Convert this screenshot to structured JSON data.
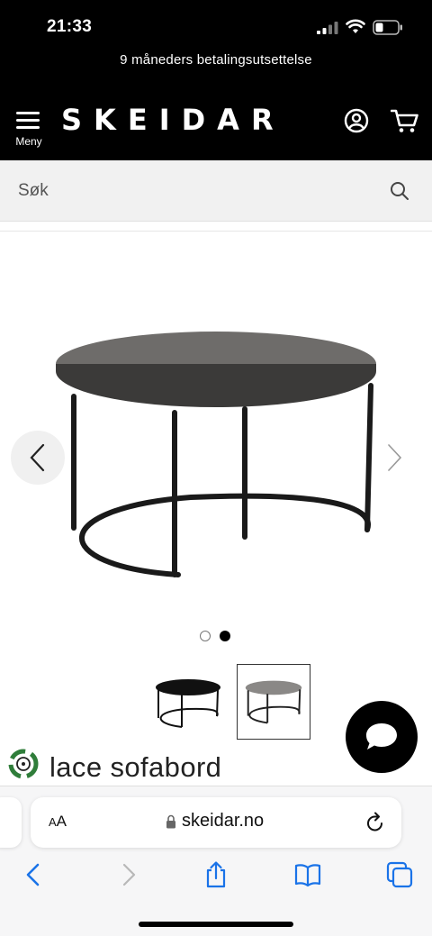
{
  "status_bar": {
    "time": "21:33"
  },
  "promo": {
    "text": "9 måneders betalingsutsettelse"
  },
  "header": {
    "menu_label": "Meny",
    "logo": "SKEIDAR",
    "account_icon": "user-icon",
    "cart_icon": "cart-icon"
  },
  "search": {
    "placeholder": "Søk",
    "icon": "search-icon"
  },
  "gallery": {
    "dots": 2,
    "active_index": 2,
    "thumbnails": 2,
    "active_thumbnail": 2
  },
  "product": {
    "title": "lace sofabord"
  },
  "browser": {
    "aa_label": "AA",
    "url": "skeidar.no"
  },
  "colors": {
    "header_bg": "#000000",
    "accent": "#000000",
    "eco_green": "#2f7d3a"
  }
}
